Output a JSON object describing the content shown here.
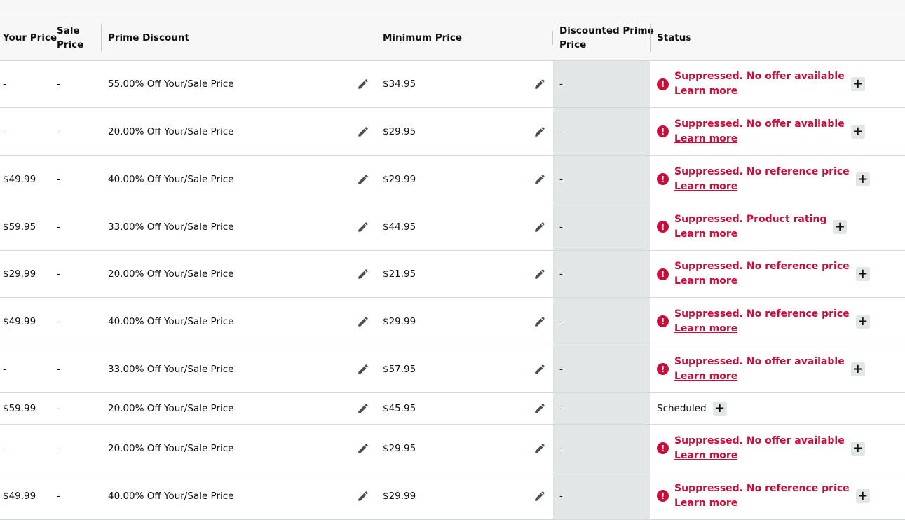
{
  "columns": {
    "your_price": "Your Price",
    "sale_price_line1": "Sale",
    "sale_price_line2": "Price",
    "prime_discount": "Prime Discount",
    "minimum_price": "Minimum Price",
    "discounted_prime_line1": "Discounted Prime",
    "discounted_prime_line2": "Price",
    "status": "Status"
  },
  "learn_more": "Learn more",
  "colors": {
    "error": "#cc0c39",
    "shaded_column": "#e3e6e6",
    "header_bg": "#f7f7f7"
  },
  "icons": {
    "edit": "pencil-icon",
    "alert": "exclamation-circle-icon",
    "expand": "plus-icon"
  },
  "rows": [
    {
      "your_price": "-",
      "sale_price": "-",
      "prime_discount": "55.00% Off Your/Sale Price",
      "minimum_price": "$34.95",
      "discounted_prime_price": "-",
      "status_type": "suppressed",
      "status": "Suppressed. No offer available"
    },
    {
      "your_price": "-",
      "sale_price": "-",
      "prime_discount": "20.00% Off Your/Sale Price",
      "minimum_price": "$29.95",
      "discounted_prime_price": "-",
      "status_type": "suppressed",
      "status": "Suppressed. No offer available"
    },
    {
      "your_price": "$49.99",
      "sale_price": "-",
      "prime_discount": "40.00% Off Your/Sale Price",
      "minimum_price": "$29.99",
      "discounted_prime_price": "-",
      "status_type": "suppressed",
      "status": "Suppressed. No reference price"
    },
    {
      "your_price": "$59.95",
      "sale_price": "-",
      "prime_discount": "33.00% Off Your/Sale Price",
      "minimum_price": "$44.95",
      "discounted_prime_price": "-",
      "status_type": "suppressed",
      "status": "Suppressed. Product rating"
    },
    {
      "your_price": "$29.99",
      "sale_price": "-",
      "prime_discount": "20.00% Off Your/Sale Price",
      "minimum_price": "$21.95",
      "discounted_prime_price": "-",
      "status_type": "suppressed",
      "status": "Suppressed. No reference price"
    },
    {
      "your_price": "$49.99",
      "sale_price": "-",
      "prime_discount": "40.00% Off Your/Sale Price",
      "minimum_price": "$29.99",
      "discounted_prime_price": "-",
      "status_type": "suppressed",
      "status": "Suppressed. No reference price"
    },
    {
      "your_price": "-",
      "sale_price": "-",
      "prime_discount": "33.00% Off Your/Sale Price",
      "minimum_price": "$57.95",
      "discounted_prime_price": "-",
      "status_type": "suppressed",
      "status": "Suppressed. No offer available"
    },
    {
      "your_price": "$59.99",
      "sale_price": "-",
      "prime_discount": "20.00% Off Your/Sale Price",
      "minimum_price": "$45.95",
      "discounted_prime_price": "-",
      "status_type": "scheduled",
      "status": "Scheduled"
    },
    {
      "your_price": "-",
      "sale_price": "-",
      "prime_discount": "20.00% Off Your/Sale Price",
      "minimum_price": "$29.95",
      "discounted_prime_price": "-",
      "status_type": "suppressed",
      "status": "Suppressed. No offer available"
    },
    {
      "your_price": "$49.99",
      "sale_price": "-",
      "prime_discount": "40.00% Off Your/Sale Price",
      "minimum_price": "$29.99",
      "discounted_prime_price": "-",
      "status_type": "suppressed",
      "status": "Suppressed. No reference price"
    }
  ]
}
